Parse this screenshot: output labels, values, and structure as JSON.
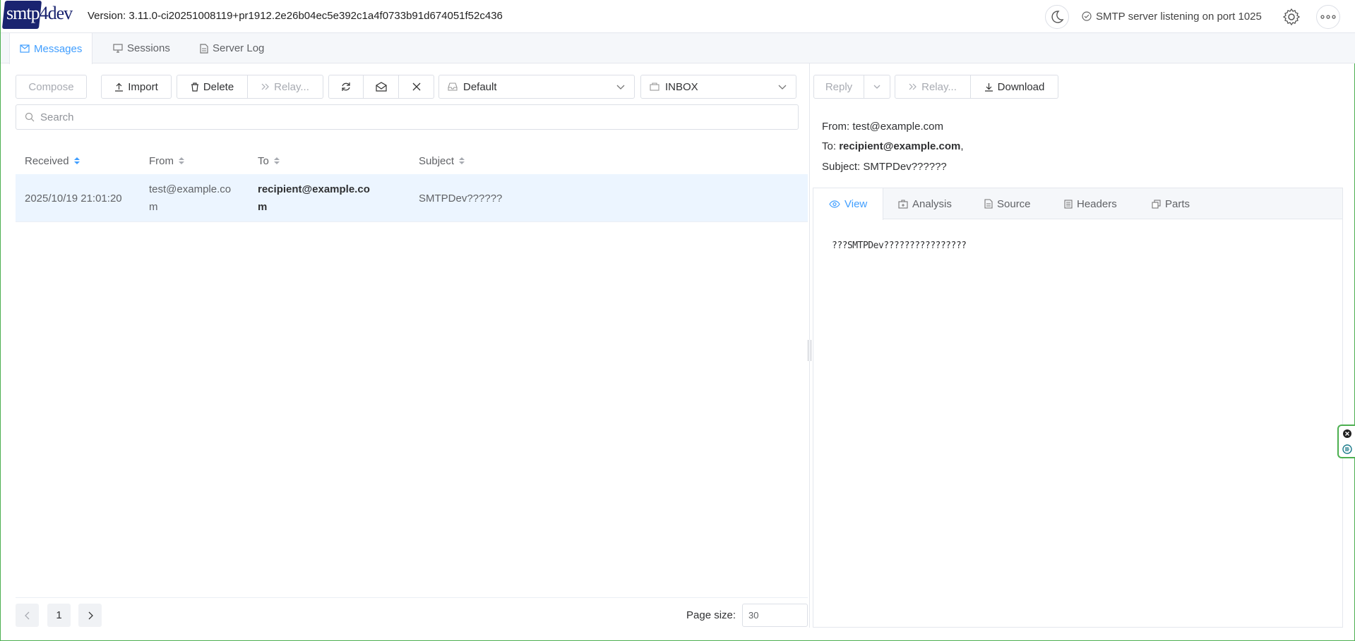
{
  "app": {
    "logo_text_a": "smtp",
    "logo_text_b": "4dev",
    "version": "Version: 3.11.0-ci20251008119+pr1912.2e26b04ec5e392c1a4f0733b91d674051f52c436",
    "status": "SMTP server listening on port 1025"
  },
  "tabs": [
    {
      "label": "Messages",
      "icon": "mail-icon",
      "active": true
    },
    {
      "label": "Sessions",
      "icon": "monitor-icon",
      "active": false
    },
    {
      "label": "Server Log",
      "icon": "document-icon",
      "active": false
    }
  ],
  "toolbar": {
    "compose": "Compose",
    "import": "Import",
    "delete": "Delete",
    "relay": "Relay...",
    "mailbox": "Default",
    "folder": "INBOX"
  },
  "search": {
    "placeholder": "Search"
  },
  "table": {
    "headers": [
      "Received",
      "From",
      "To",
      "Subject"
    ],
    "rows": [
      {
        "received": "2025/10/19 21:01:20",
        "from_1": "test@example.co",
        "from_2": "m",
        "to_1": "recipient@example.co",
        "to_2": "m",
        "subject": "SMTPDev??????"
      }
    ]
  },
  "pagination": {
    "current": "1",
    "page_size_label": "Page size:",
    "page_size": "30"
  },
  "detail": {
    "reply": "Reply",
    "relay": "Relay...",
    "download": "Download",
    "from_label": "From:",
    "from": "test@example.com",
    "to_label": "To:",
    "to": "recipient@example.com",
    "to_suffix": ",",
    "subject_label": "Subject:",
    "subject": "SMTPDev??????",
    "tabs": [
      "View",
      "Analysis",
      "Source",
      "Headers",
      "Parts"
    ],
    "body": "???SMTPDev????????????????"
  },
  "colors": {
    "accent": "#409eff",
    "selected_row": "#ecf5ff",
    "logo": "#1a2470",
    "frame": "#4caf50"
  }
}
